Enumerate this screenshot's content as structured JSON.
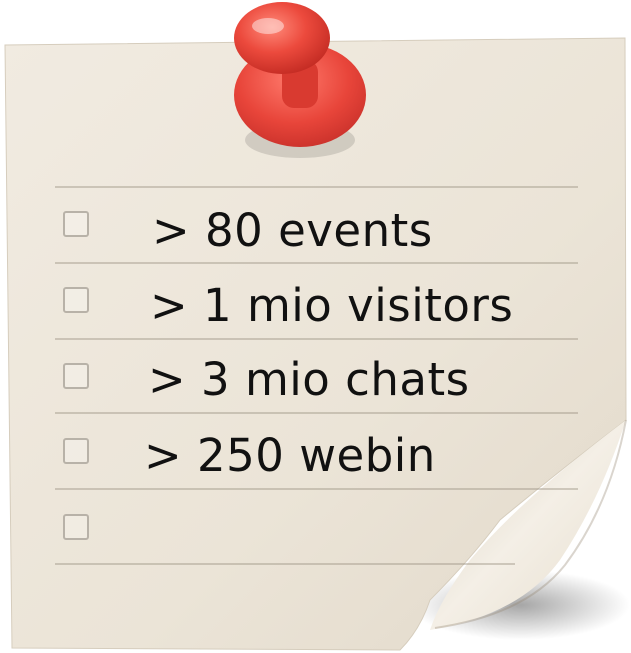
{
  "checklist": {
    "items": [
      {
        "label": "> 80 events",
        "checked": false
      },
      {
        "label": "> 1 mio visitors",
        "checked": false
      },
      {
        "label": "> 3 mio chats",
        "checked": false
      },
      {
        "label": "> 250 webin",
        "checked": false
      },
      {
        "label": "",
        "checked": false
      }
    ]
  },
  "colors": {
    "paper": "#ede6da",
    "pin": "#e8453a",
    "text": "#111111"
  },
  "icons": {
    "pin": "pushpin-icon",
    "checkbox": "checkbox-icon"
  }
}
